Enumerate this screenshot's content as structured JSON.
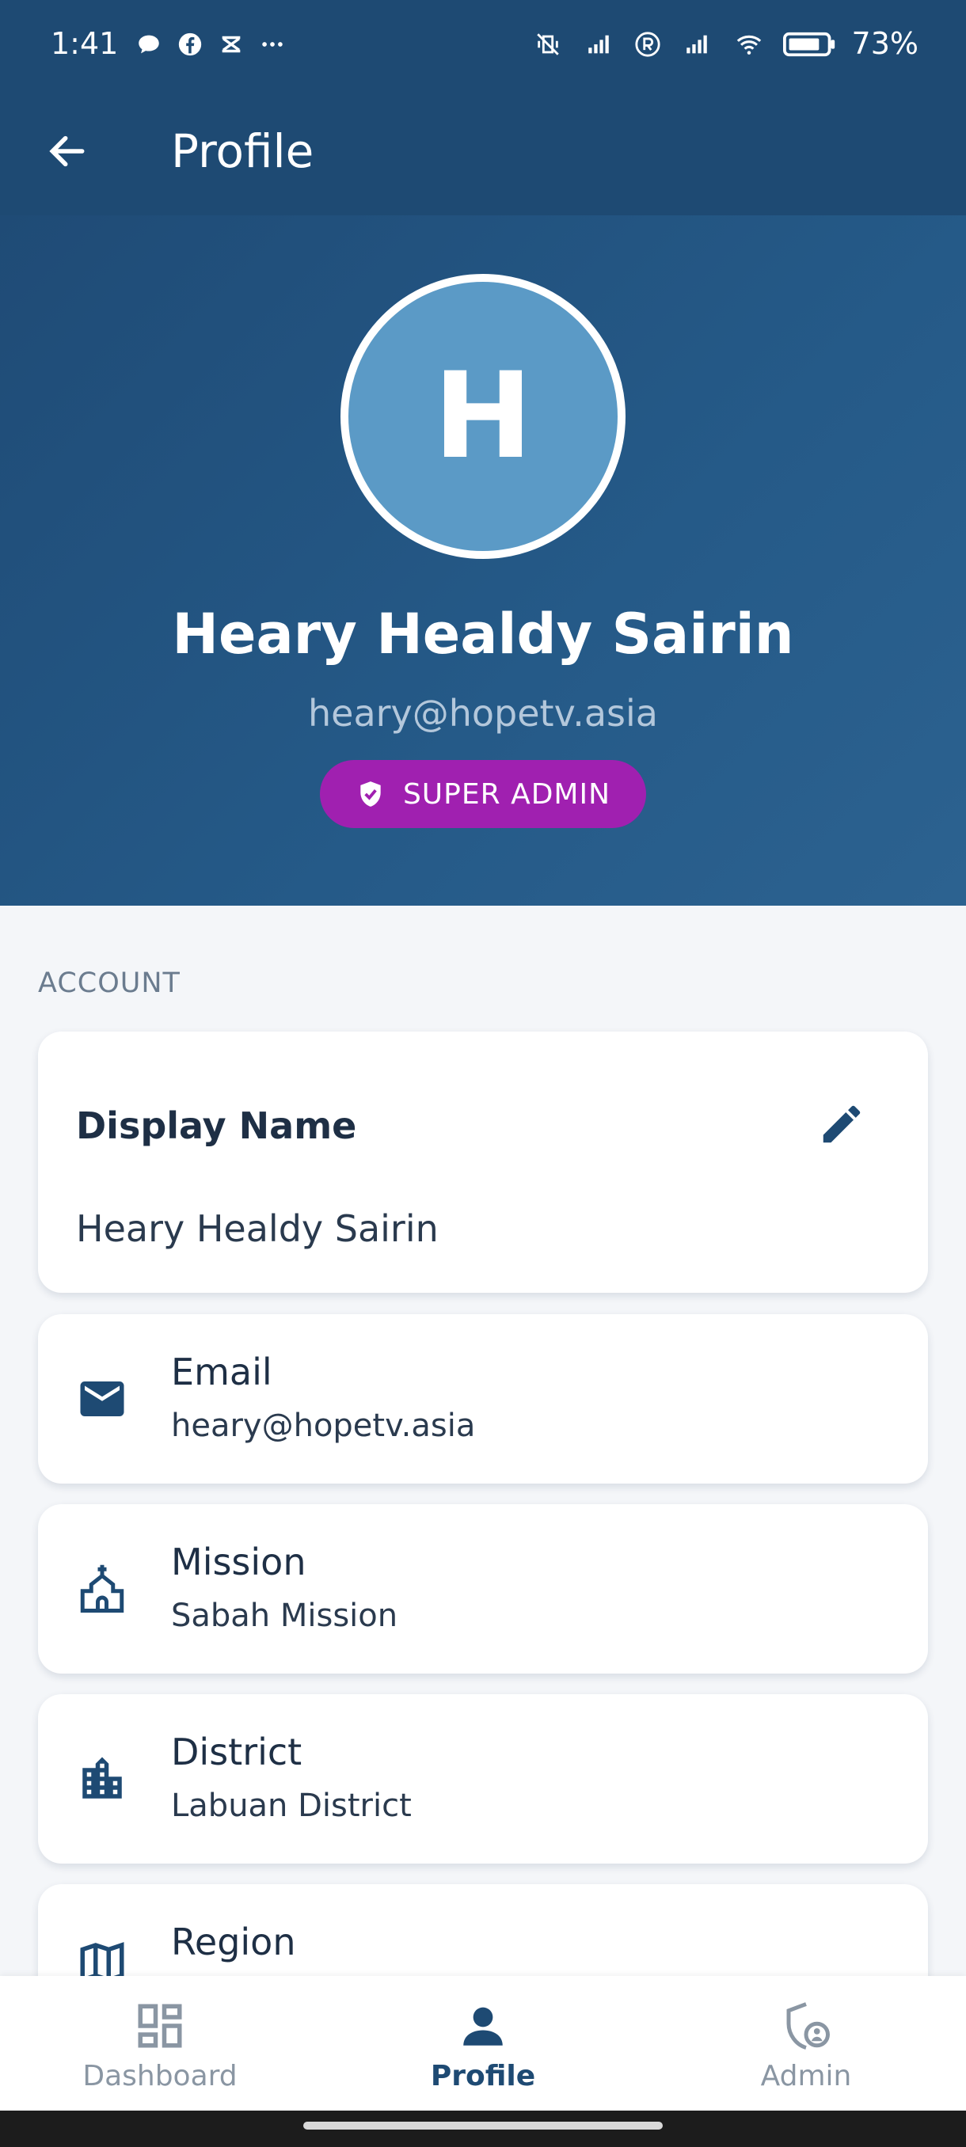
{
  "status_bar": {
    "time": "1:41",
    "battery": "73%"
  },
  "app_bar": {
    "title": "Profile"
  },
  "profile": {
    "avatar_initial": "H",
    "name": "Heary Healdy Sairin",
    "email": "heary@hopetv.asia",
    "role": "SUPER ADMIN"
  },
  "section": {
    "account_label": "ACCOUNT"
  },
  "display_name_card": {
    "title": "Display Name",
    "value": "Heary Healdy Sairin"
  },
  "info_cards": [
    {
      "label": "Email",
      "value": "heary@hopetv.asia",
      "icon": "mail-icon"
    },
    {
      "label": "Mission",
      "value": "Sabah Mission",
      "icon": "church-icon"
    },
    {
      "label": "District",
      "value": "Labuan District",
      "icon": "building-icon"
    },
    {
      "label": "Region",
      "value": "",
      "icon": "map-icon"
    }
  ],
  "bottom_nav": {
    "items": [
      {
        "label": "Dashboard",
        "icon": "dashboard-icon",
        "active": false
      },
      {
        "label": "Profile",
        "icon": "person-icon",
        "active": true
      },
      {
        "label": "Admin",
        "icon": "admin-shield-icon",
        "active": false
      }
    ]
  },
  "colors": {
    "primary": "#1e4a73",
    "avatar_bg": "#5b9ac6",
    "role_badge": "#a020b0",
    "background": "#f4f6f9"
  }
}
